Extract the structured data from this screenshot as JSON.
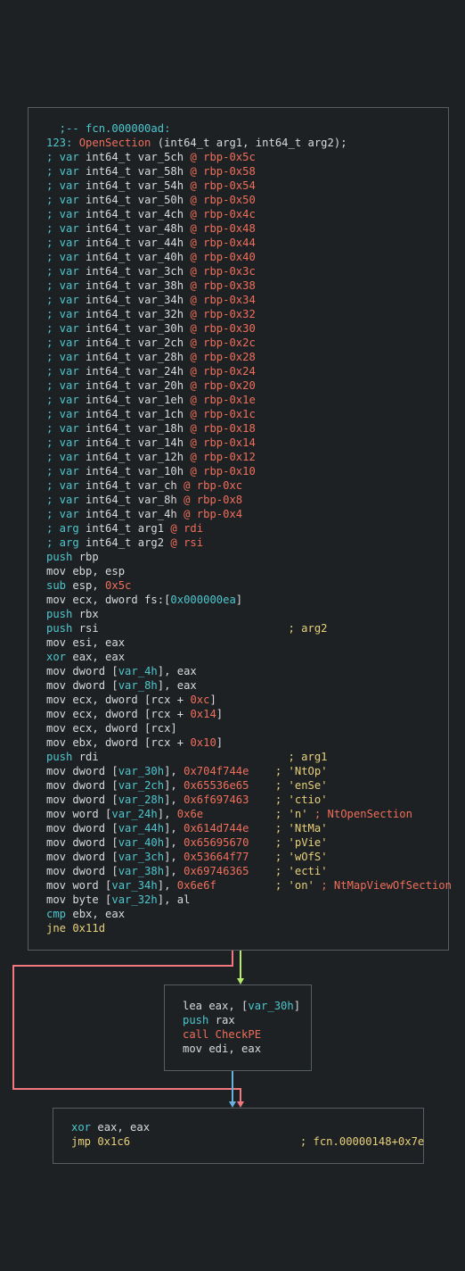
{
  "colors": {
    "background": "#1e2124",
    "node_border": "#585d62",
    "text": "#d8dadc",
    "keyword_cyan": "#4dc6ce",
    "immediate_red": "#ef6e5a",
    "comment_yellow": "#e7d07a",
    "edge_false": "#f2787e",
    "edge_true": "#b6ec6a",
    "edge_uncond": "#6ab0df"
  },
  "nodes": [
    {
      "name": "block-main",
      "lines": [
        [
          {
            "t": "  ;-- fcn.000000ad:",
            "c": "cyan"
          }
        ],
        [
          {
            "t": "123: ",
            "c": "cyan"
          },
          {
            "t": "OpenSection",
            "c": "red"
          },
          {
            "t": " (int64_t arg1, int64_t arg2);",
            "c": "white"
          }
        ],
        [
          {
            "t": "; var ",
            "c": "cyan"
          },
          {
            "t": "int64_t var_5ch ",
            "c": "white"
          },
          {
            "t": "@ rbp-0x5c",
            "c": "red"
          }
        ],
        [
          {
            "t": "; var ",
            "c": "cyan"
          },
          {
            "t": "int64_t var_58h ",
            "c": "white"
          },
          {
            "t": "@ rbp-0x58",
            "c": "red"
          }
        ],
        [
          {
            "t": "; var ",
            "c": "cyan"
          },
          {
            "t": "int64_t var_54h ",
            "c": "white"
          },
          {
            "t": "@ rbp-0x54",
            "c": "red"
          }
        ],
        [
          {
            "t": "; var ",
            "c": "cyan"
          },
          {
            "t": "int64_t var_50h ",
            "c": "white"
          },
          {
            "t": "@ rbp-0x50",
            "c": "red"
          }
        ],
        [
          {
            "t": "; var ",
            "c": "cyan"
          },
          {
            "t": "int64_t var_4ch ",
            "c": "white"
          },
          {
            "t": "@ rbp-0x4c",
            "c": "red"
          }
        ],
        [
          {
            "t": "; var ",
            "c": "cyan"
          },
          {
            "t": "int64_t var_48h ",
            "c": "white"
          },
          {
            "t": "@ rbp-0x48",
            "c": "red"
          }
        ],
        [
          {
            "t": "; var ",
            "c": "cyan"
          },
          {
            "t": "int64_t var_44h ",
            "c": "white"
          },
          {
            "t": "@ rbp-0x44",
            "c": "red"
          }
        ],
        [
          {
            "t": "; var ",
            "c": "cyan"
          },
          {
            "t": "int64_t var_40h ",
            "c": "white"
          },
          {
            "t": "@ rbp-0x40",
            "c": "red"
          }
        ],
        [
          {
            "t": "; var ",
            "c": "cyan"
          },
          {
            "t": "int64_t var_3ch ",
            "c": "white"
          },
          {
            "t": "@ rbp-0x3c",
            "c": "red"
          }
        ],
        [
          {
            "t": "; var ",
            "c": "cyan"
          },
          {
            "t": "int64_t var_38h ",
            "c": "white"
          },
          {
            "t": "@ rbp-0x38",
            "c": "red"
          }
        ],
        [
          {
            "t": "; var ",
            "c": "cyan"
          },
          {
            "t": "int64_t var_34h ",
            "c": "white"
          },
          {
            "t": "@ rbp-0x34",
            "c": "red"
          }
        ],
        [
          {
            "t": "; var ",
            "c": "cyan"
          },
          {
            "t": "int64_t var_32h ",
            "c": "white"
          },
          {
            "t": "@ rbp-0x32",
            "c": "red"
          }
        ],
        [
          {
            "t": "; var ",
            "c": "cyan"
          },
          {
            "t": "int64_t var_30h ",
            "c": "white"
          },
          {
            "t": "@ rbp-0x30",
            "c": "red"
          }
        ],
        [
          {
            "t": "; var ",
            "c": "cyan"
          },
          {
            "t": "int64_t var_2ch ",
            "c": "white"
          },
          {
            "t": "@ rbp-0x2c",
            "c": "red"
          }
        ],
        [
          {
            "t": "; var ",
            "c": "cyan"
          },
          {
            "t": "int64_t var_28h ",
            "c": "white"
          },
          {
            "t": "@ rbp-0x28",
            "c": "red"
          }
        ],
        [
          {
            "t": "; var ",
            "c": "cyan"
          },
          {
            "t": "int64_t var_24h ",
            "c": "white"
          },
          {
            "t": "@ rbp-0x24",
            "c": "red"
          }
        ],
        [
          {
            "t": "; var ",
            "c": "cyan"
          },
          {
            "t": "int64_t var_20h ",
            "c": "white"
          },
          {
            "t": "@ rbp-0x20",
            "c": "red"
          }
        ],
        [
          {
            "t": "; var ",
            "c": "cyan"
          },
          {
            "t": "int64_t var_1eh ",
            "c": "white"
          },
          {
            "t": "@ rbp-0x1e",
            "c": "red"
          }
        ],
        [
          {
            "t": "; var ",
            "c": "cyan"
          },
          {
            "t": "int64_t var_1ch ",
            "c": "white"
          },
          {
            "t": "@ rbp-0x1c",
            "c": "red"
          }
        ],
        [
          {
            "t": "; var ",
            "c": "cyan"
          },
          {
            "t": "int64_t var_18h ",
            "c": "white"
          },
          {
            "t": "@ rbp-0x18",
            "c": "red"
          }
        ],
        [
          {
            "t": "; var ",
            "c": "cyan"
          },
          {
            "t": "int64_t var_14h ",
            "c": "white"
          },
          {
            "t": "@ rbp-0x14",
            "c": "red"
          }
        ],
        [
          {
            "t": "; var ",
            "c": "cyan"
          },
          {
            "t": "int64_t var_12h ",
            "c": "white"
          },
          {
            "t": "@ rbp-0x12",
            "c": "red"
          }
        ],
        [
          {
            "t": "; var ",
            "c": "cyan"
          },
          {
            "t": "int64_t var_10h ",
            "c": "white"
          },
          {
            "t": "@ rbp-0x10",
            "c": "red"
          }
        ],
        [
          {
            "t": "; var ",
            "c": "cyan"
          },
          {
            "t": "int64_t var_ch ",
            "c": "white"
          },
          {
            "t": "@ rbp-0xc",
            "c": "red"
          }
        ],
        [
          {
            "t": "; var ",
            "c": "cyan"
          },
          {
            "t": "int64_t var_8h ",
            "c": "white"
          },
          {
            "t": "@ rbp-0x8",
            "c": "red"
          }
        ],
        [
          {
            "t": "; var ",
            "c": "cyan"
          },
          {
            "t": "int64_t var_4h ",
            "c": "white"
          },
          {
            "t": "@ rbp-0x4",
            "c": "red"
          }
        ],
        [
          {
            "t": "; arg ",
            "c": "cyan"
          },
          {
            "t": "int64_t arg1 ",
            "c": "white"
          },
          {
            "t": "@ rdi",
            "c": "red"
          }
        ],
        [
          {
            "t": "; arg ",
            "c": "cyan"
          },
          {
            "t": "int64_t arg2 ",
            "c": "white"
          },
          {
            "t": "@ rsi",
            "c": "red"
          }
        ],
        [
          {
            "t": "push",
            "c": "cyan"
          },
          {
            "t": " rbp",
            "c": "white"
          }
        ],
        [
          {
            "t": "mov ebp, esp",
            "c": "white"
          }
        ],
        [
          {
            "t": "sub",
            "c": "cyan"
          },
          {
            "t": " esp, ",
            "c": "white"
          },
          {
            "t": "0x5c",
            "c": "red"
          }
        ],
        [
          {
            "t": "mov ecx, dword fs:[",
            "c": "white"
          },
          {
            "t": "0x000000ea",
            "c": "cyan"
          },
          {
            "t": "]",
            "c": "white"
          }
        ],
        [
          {
            "t": "push",
            "c": "cyan"
          },
          {
            "t": " rbx",
            "c": "white"
          }
        ],
        [
          {
            "t": "push",
            "c": "cyan"
          },
          {
            "t": " rsi                             ",
            "c": "white"
          },
          {
            "t": "; arg2",
            "c": "yellow"
          }
        ],
        [
          {
            "t": "mov esi, eax",
            "c": "white"
          }
        ],
        [
          {
            "t": "xor",
            "c": "cyan"
          },
          {
            "t": " eax, eax",
            "c": "white"
          }
        ],
        [
          {
            "t": "mov dword [",
            "c": "white"
          },
          {
            "t": "var_4h",
            "c": "cyan"
          },
          {
            "t": "], eax",
            "c": "white"
          }
        ],
        [
          {
            "t": "mov dword [",
            "c": "white"
          },
          {
            "t": "var_8h",
            "c": "cyan"
          },
          {
            "t": "], eax",
            "c": "white"
          }
        ],
        [
          {
            "t": "mov ecx, dword [rcx + ",
            "c": "white"
          },
          {
            "t": "0xc",
            "c": "red"
          },
          {
            "t": "]",
            "c": "white"
          }
        ],
        [
          {
            "t": "mov ecx, dword [rcx + ",
            "c": "white"
          },
          {
            "t": "0x14",
            "c": "red"
          },
          {
            "t": "]",
            "c": "white"
          }
        ],
        [
          {
            "t": "mov ecx, dword [rcx]",
            "c": "white"
          }
        ],
        [
          {
            "t": "mov ebx, dword [rcx + ",
            "c": "white"
          },
          {
            "t": "0x10",
            "c": "red"
          },
          {
            "t": "]",
            "c": "white"
          }
        ],
        [
          {
            "t": "push",
            "c": "cyan"
          },
          {
            "t": " rdi                             ",
            "c": "white"
          },
          {
            "t": "; arg1",
            "c": "yellow"
          }
        ],
        [
          {
            "t": "mov dword [",
            "c": "white"
          },
          {
            "t": "var_30h",
            "c": "cyan"
          },
          {
            "t": "], ",
            "c": "white"
          },
          {
            "t": "0x704f744e",
            "c": "red"
          },
          {
            "t": "    ",
            "c": "white"
          },
          {
            "t": "; 'NtOp'",
            "c": "yellow"
          }
        ],
        [
          {
            "t": "mov dword [",
            "c": "white"
          },
          {
            "t": "var_2ch",
            "c": "cyan"
          },
          {
            "t": "], ",
            "c": "white"
          },
          {
            "t": "0x65536e65",
            "c": "red"
          },
          {
            "t": "    ",
            "c": "white"
          },
          {
            "t": "; 'enSe'",
            "c": "yellow"
          }
        ],
        [
          {
            "t": "mov dword [",
            "c": "white"
          },
          {
            "t": "var_28h",
            "c": "cyan"
          },
          {
            "t": "], ",
            "c": "white"
          },
          {
            "t": "0x6f697463",
            "c": "red"
          },
          {
            "t": "    ",
            "c": "white"
          },
          {
            "t": "; 'ctio'",
            "c": "yellow"
          }
        ],
        [
          {
            "t": "mov word [",
            "c": "white"
          },
          {
            "t": "var_24h",
            "c": "cyan"
          },
          {
            "t": "], ",
            "c": "white"
          },
          {
            "t": "0x6e",
            "c": "red"
          },
          {
            "t": "           ",
            "c": "white"
          },
          {
            "t": "; 'n' ",
            "c": "yellow"
          },
          {
            "t": "; NtOpenSection",
            "c": "red"
          }
        ],
        [
          {
            "t": "mov dword [",
            "c": "white"
          },
          {
            "t": "var_44h",
            "c": "cyan"
          },
          {
            "t": "], ",
            "c": "white"
          },
          {
            "t": "0x614d744e",
            "c": "red"
          },
          {
            "t": "    ",
            "c": "white"
          },
          {
            "t": "; 'NtMa'",
            "c": "yellow"
          }
        ],
        [
          {
            "t": "mov dword [",
            "c": "white"
          },
          {
            "t": "var_40h",
            "c": "cyan"
          },
          {
            "t": "], ",
            "c": "white"
          },
          {
            "t": "0x65695670",
            "c": "red"
          },
          {
            "t": "    ",
            "c": "white"
          },
          {
            "t": "; 'pVie'",
            "c": "yellow"
          }
        ],
        [
          {
            "t": "mov dword [",
            "c": "white"
          },
          {
            "t": "var_3ch",
            "c": "cyan"
          },
          {
            "t": "], ",
            "c": "white"
          },
          {
            "t": "0x53664f77",
            "c": "red"
          },
          {
            "t": "    ",
            "c": "white"
          },
          {
            "t": "; 'wOfS'",
            "c": "yellow"
          }
        ],
        [
          {
            "t": "mov dword [",
            "c": "white"
          },
          {
            "t": "var_38h",
            "c": "cyan"
          },
          {
            "t": "], ",
            "c": "white"
          },
          {
            "t": "0x69746365",
            "c": "red"
          },
          {
            "t": "    ",
            "c": "white"
          },
          {
            "t": "; 'ecti'",
            "c": "yellow"
          }
        ],
        [
          {
            "t": "mov word [",
            "c": "white"
          },
          {
            "t": "var_34h",
            "c": "cyan"
          },
          {
            "t": "], ",
            "c": "white"
          },
          {
            "t": "0x6e6f",
            "c": "red"
          },
          {
            "t": "         ",
            "c": "white"
          },
          {
            "t": "; 'on' ",
            "c": "yellow"
          },
          {
            "t": "; NtMapViewOfSection",
            "c": "red"
          }
        ],
        [
          {
            "t": "mov byte [",
            "c": "white"
          },
          {
            "t": "var_32h",
            "c": "cyan"
          },
          {
            "t": "], al",
            "c": "white"
          }
        ],
        [
          {
            "t": "cmp",
            "c": "cyan"
          },
          {
            "t": " ebx, eax",
            "c": "white"
          }
        ],
        [
          {
            "t": "jne 0x11d",
            "c": "yellow"
          }
        ]
      ]
    },
    {
      "name": "block-checkpe",
      "lines": [
        [
          {
            "t": "lea eax, [",
            "c": "white"
          },
          {
            "t": "var_30h",
            "c": "cyan"
          },
          {
            "t": "]",
            "c": "white"
          }
        ],
        [
          {
            "t": "push",
            "c": "cyan"
          },
          {
            "t": " rax",
            "c": "white"
          }
        ],
        [
          {
            "t": "call CheckPE",
            "c": "red"
          }
        ],
        [
          {
            "t": "mov edi, eax",
            "c": "white"
          }
        ]
      ]
    },
    {
      "name": "block-exit",
      "lines": [
        [
          {
            "t": "xor",
            "c": "cyan"
          },
          {
            "t": " eax, eax",
            "c": "white"
          }
        ],
        [
          {
            "t": "jmp 0x1c6",
            "c": "yellow"
          },
          {
            "t": "                          ",
            "c": "white"
          },
          {
            "t": "; fcn.00000148+0x7e",
            "c": "yellow"
          }
        ]
      ]
    }
  ]
}
